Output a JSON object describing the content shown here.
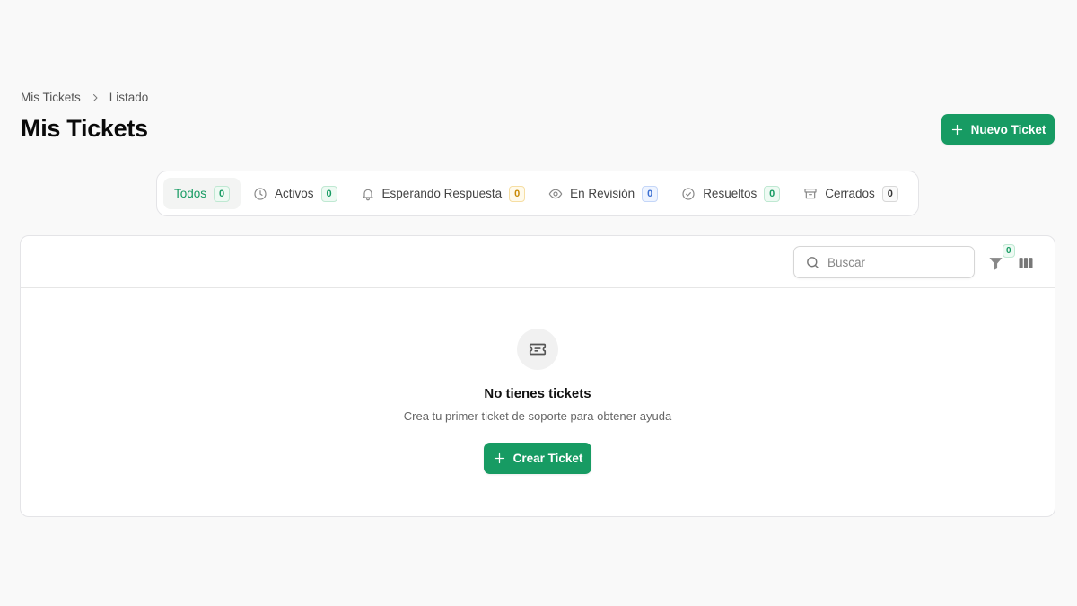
{
  "breadcrumb": {
    "root": "Mis Tickets",
    "current": "Listado"
  },
  "page": {
    "title": "Mis Tickets"
  },
  "actions": {
    "new_ticket_label": "Nuevo Ticket"
  },
  "tabs": [
    {
      "label": "Todos",
      "count": "0",
      "icon": "none",
      "badge_color": "green"
    },
    {
      "label": "Activos",
      "count": "0",
      "icon": "clock-icon",
      "badge_color": "green"
    },
    {
      "label": "Esperando Respuesta",
      "count": "0",
      "icon": "bell-icon",
      "badge_color": "amber"
    },
    {
      "label": "En Revisión",
      "count": "0",
      "icon": "eye-icon",
      "badge_color": "blue"
    },
    {
      "label": "Resueltos",
      "count": "0",
      "icon": "check-circle-icon",
      "badge_color": "green"
    },
    {
      "label": "Cerrados",
      "count": "0",
      "icon": "archive-icon",
      "badge_color": "gray"
    }
  ],
  "toolbar": {
    "search_placeholder": "Buscar",
    "filter_count": "0"
  },
  "empty_state": {
    "title": "No tienes tickets",
    "subtitle": "Crea tu primer ticket de soporte para obtener ayuda",
    "button_label": "Crear Ticket"
  },
  "colors": {
    "accent": "#179b63",
    "background": "#f9f9f9"
  }
}
